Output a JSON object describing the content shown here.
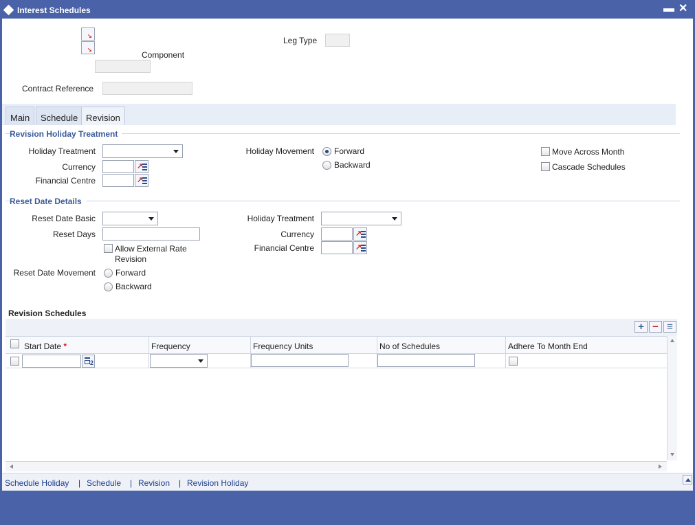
{
  "window": {
    "title": "Interest Schedules",
    "minimize": "▬",
    "close": "✕"
  },
  "header": {
    "component_label": "Component",
    "leg_type_label": "Leg Type",
    "contract_reference_label": "Contract Reference",
    "component_value": "",
    "leg_type_value": "",
    "contract_reference_value": ""
  },
  "tabs": [
    "Main",
    "Schedule",
    "Revision"
  ],
  "revision_holiday": {
    "section_title": "Revision Holiday Treatment",
    "holiday_treatment_label": "Holiday Treatment",
    "currency_label": "Currency",
    "financial_centre_label": "Financial Centre",
    "holiday_movement_label": "Holiday Movement",
    "forward_label": "Forward",
    "backward_label": "Backward",
    "move_across_month_label": "Move Across Month",
    "cascade_schedules_label": "Cascade Schedules"
  },
  "reset_date": {
    "section_title": "Reset Date Details",
    "reset_date_basic_label": "Reset Date Basic",
    "reset_days_label": "Reset Days",
    "allow_external_label_1": "Allow External Rate",
    "allow_external_label_2": "Revision",
    "reset_date_movement_label": "Reset Date Movement",
    "forward_label": "Forward",
    "backward_label": "Backward",
    "holiday_treatment_label": "Holiday Treatment",
    "currency_label": "Currency",
    "financial_centre_label": "Financial Centre"
  },
  "revision_schedules": {
    "title": "Revision Schedules",
    "columns": {
      "start_date": "Start Date",
      "required_mark": "*",
      "frequency": "Frequency",
      "frequency_units": "Frequency Units",
      "no_of_schedules": "No of Schedules",
      "adhere_to_month_end": "Adhere To Month End"
    },
    "buttons": {
      "add": "+",
      "remove": "−",
      "view": "≡"
    }
  },
  "footer_links": [
    "Schedule Holiday",
    "Schedule",
    "Revision",
    "Revision Holiday"
  ],
  "footer_separator": "|"
}
